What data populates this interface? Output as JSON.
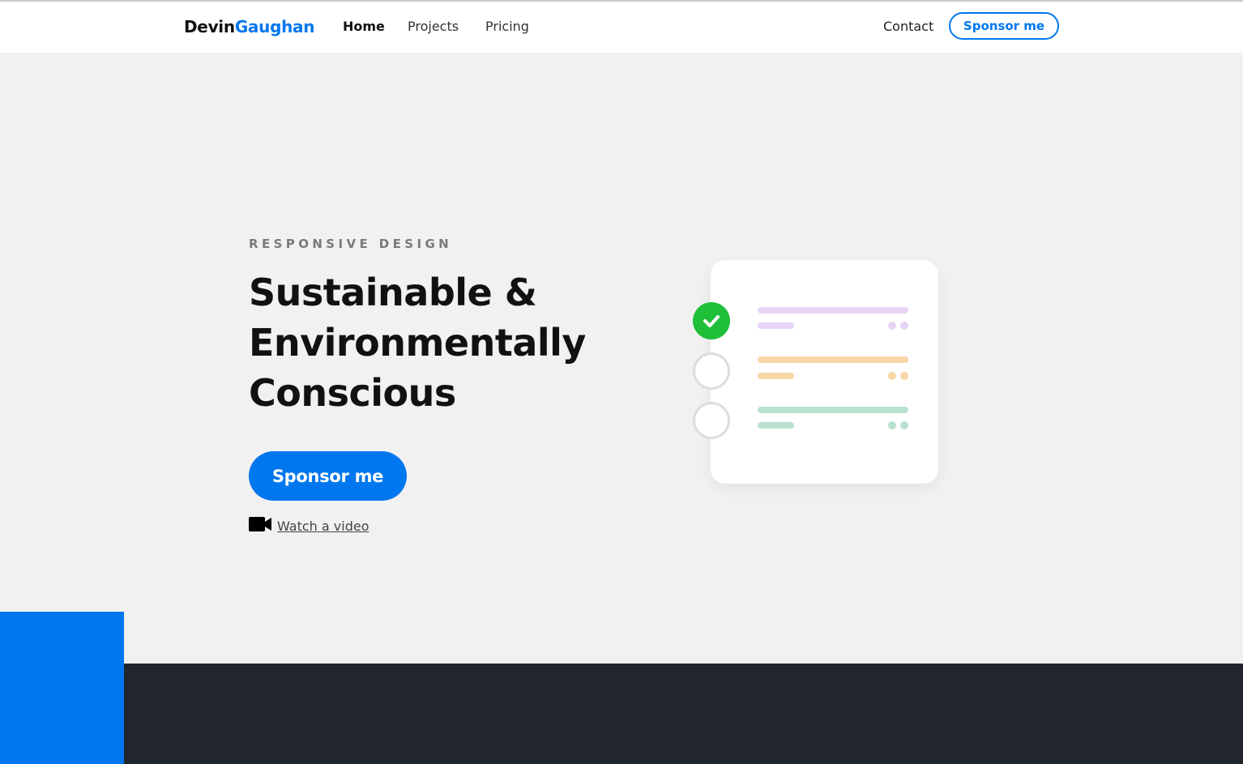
{
  "nav": {
    "logo_first": "Devin",
    "logo_last": "Gaughan",
    "links": [
      {
        "label": "Home",
        "active": true
      },
      {
        "label": "Projects",
        "active": false
      },
      {
        "label": "Pricing",
        "active": false
      }
    ],
    "contact_label": "Contact",
    "sponsor_label": "Sponsor me"
  },
  "hero": {
    "eyebrow": "RESPONSIVE DESIGN",
    "headline_lines": [
      "Sustainable &",
      "Environmentally",
      "Conscious"
    ],
    "cta_label": "Sponsor me",
    "video_icon": "video-camera-icon",
    "video_link": "Watch a video"
  },
  "illustration": {
    "tasks": [
      {
        "done": true,
        "color": "#e8d4f5"
      },
      {
        "done": false,
        "color": "#f8d6a6"
      },
      {
        "done": false,
        "color": "#b8e2cf"
      }
    ],
    "check_icon": "checkmark-icon"
  },
  "colors": {
    "accent": "#0077ee",
    "dark": "#21262e",
    "success": "#1fbf3a",
    "background": "#f1f1f1"
  }
}
